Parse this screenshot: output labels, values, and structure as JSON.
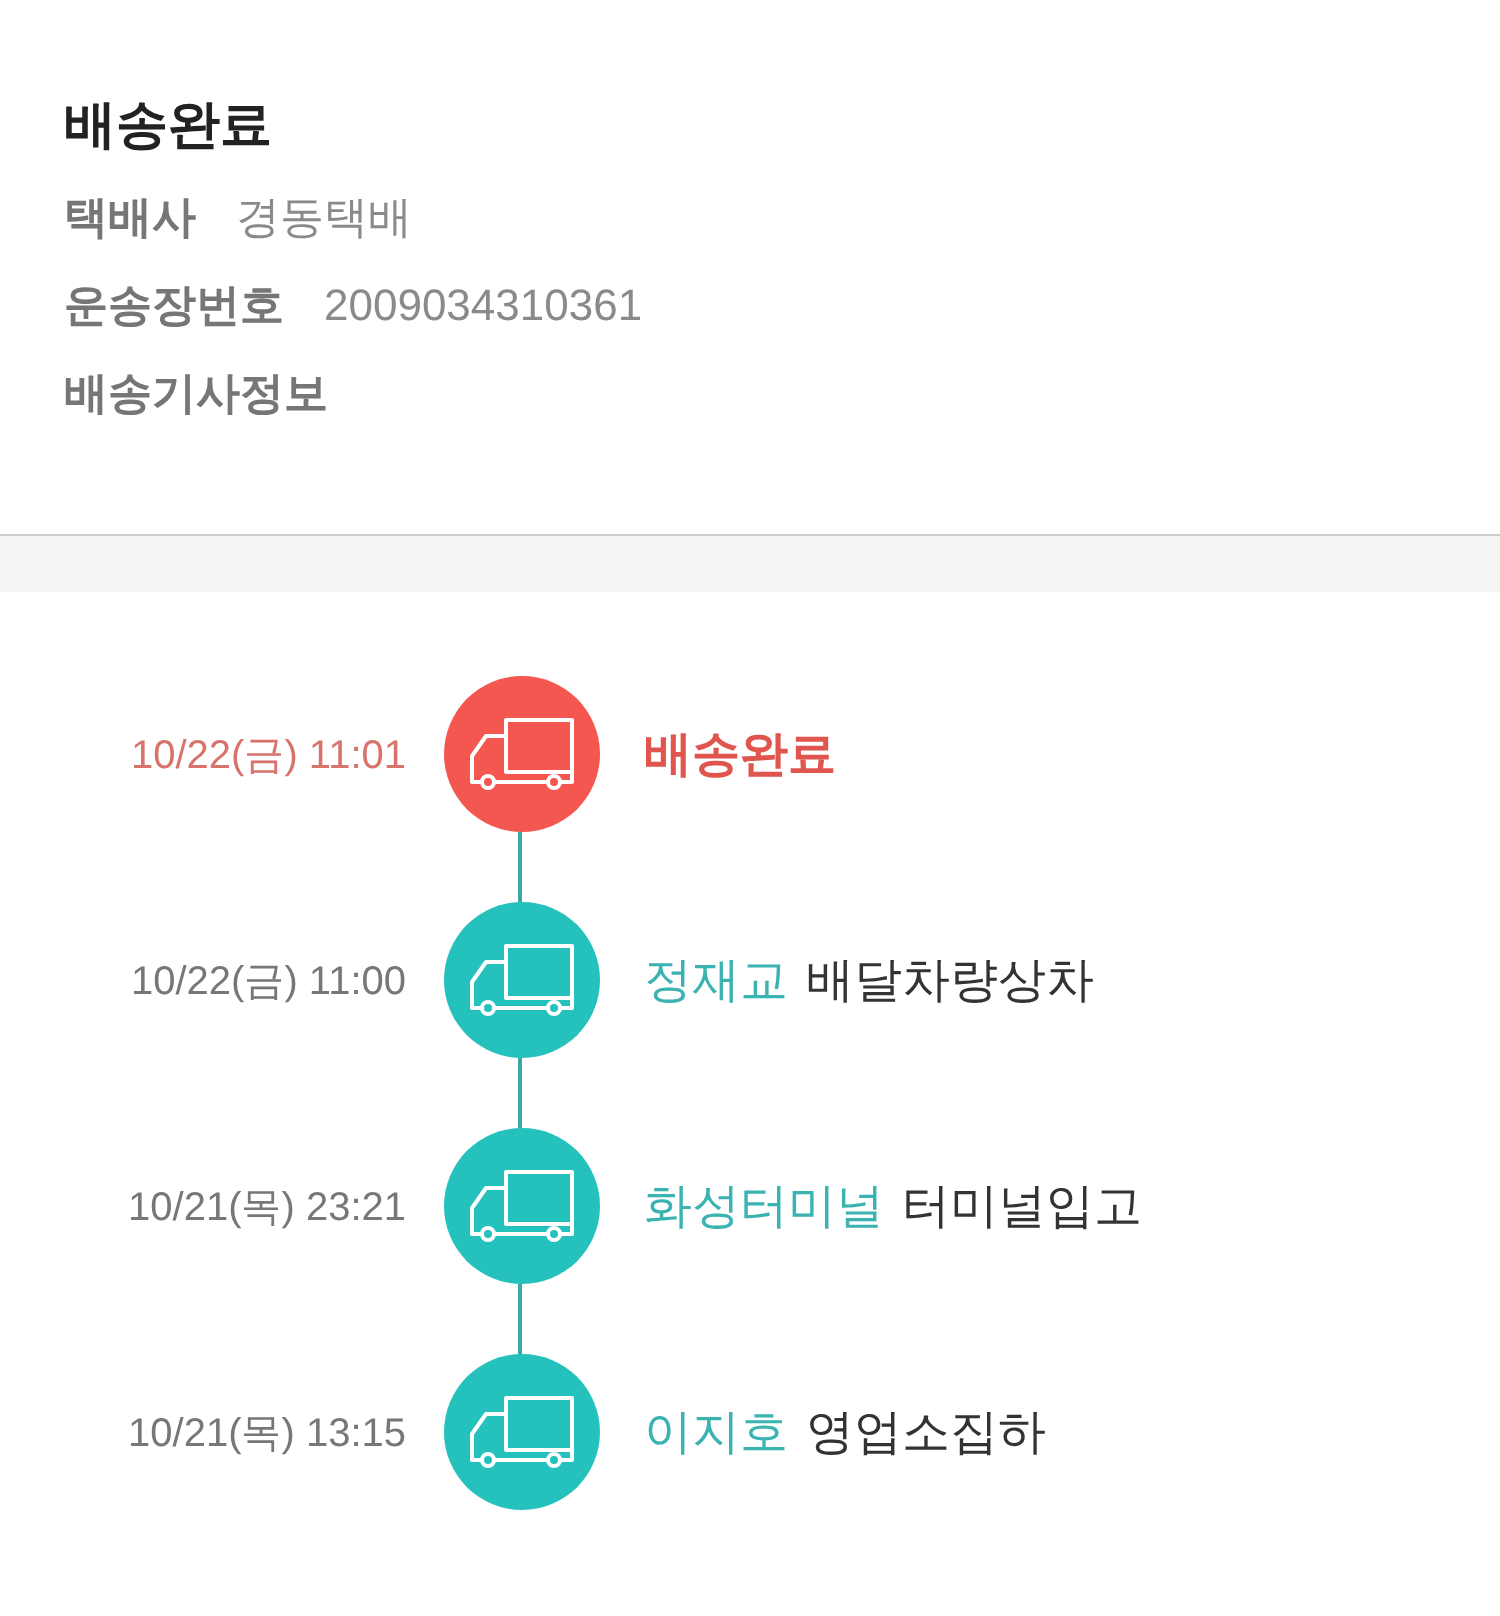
{
  "summary": {
    "title": "배송완료",
    "fields": [
      {
        "label": "택배사",
        "value": "경동택배"
      },
      {
        "label": "운송장번호",
        "value": "2009034310361"
      },
      {
        "label": "배송기사정보"
      }
    ]
  },
  "timeline": [
    {
      "time": "10/22(금) 11:01",
      "status": "배송완료",
      "current": true
    },
    {
      "time": "10/22(금) 11:00",
      "location": "정재교",
      "status": "배달차량상차",
      "current": false
    },
    {
      "time": "10/21(목) 23:21",
      "location": "화성터미널",
      "status": "터미널입고",
      "current": false
    },
    {
      "time": "10/21(목) 13:15",
      "location": "이지호",
      "status": "영업소집하",
      "current": false
    }
  ]
}
